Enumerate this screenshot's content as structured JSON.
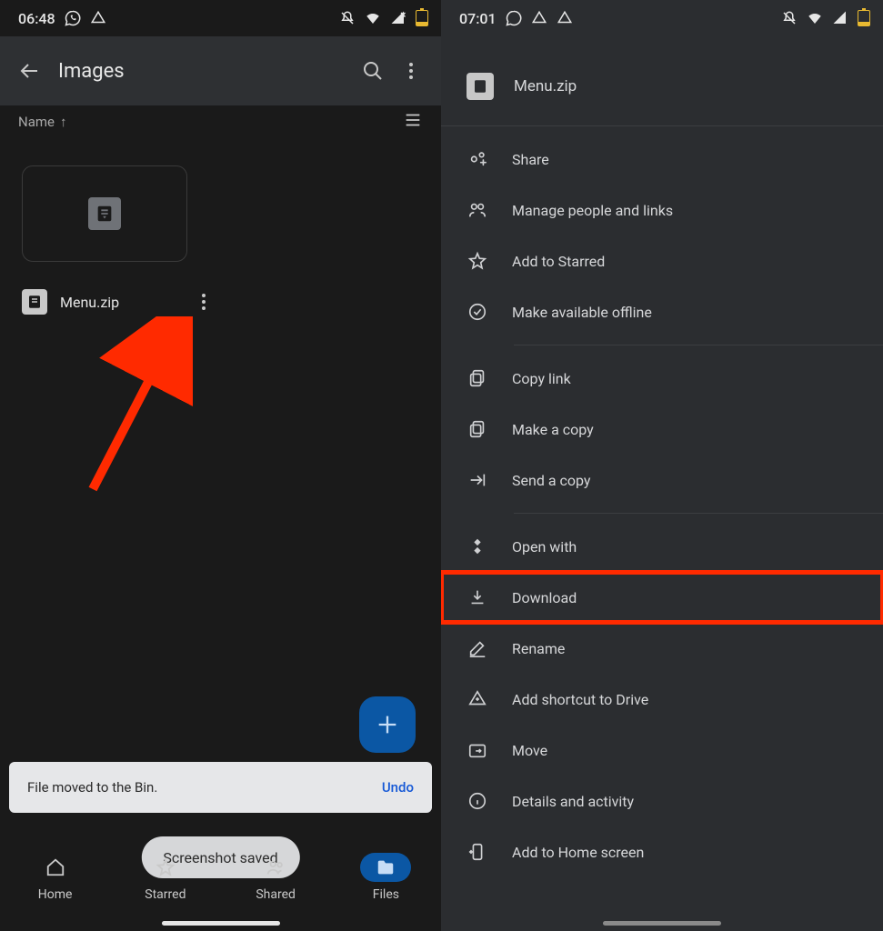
{
  "left": {
    "status": {
      "time": "06:48"
    },
    "header": {
      "title": "Images"
    },
    "sort": {
      "label": "Name"
    },
    "file": {
      "name": "Menu.zip"
    },
    "snackbar": {
      "text": "File moved to the Bin.",
      "action": "Undo"
    },
    "pill": {
      "text": "Screenshot saved"
    },
    "bottomnav": {
      "home": "Home",
      "starred": "Starred",
      "shared": "Shared",
      "files": "Files"
    }
  },
  "right": {
    "status": {
      "time": "07:01"
    },
    "file": "Menu.zip",
    "menu": {
      "share": "Share",
      "manage": "Manage people and links",
      "starred": "Add to Starred",
      "offline": "Make available offline",
      "copylink": "Copy link",
      "makecopy": "Make a copy",
      "sendcopy": "Send a copy",
      "openwith": "Open with",
      "download": "Download",
      "rename": "Rename",
      "shortcut": "Add shortcut to Drive",
      "move": "Move",
      "details": "Details and activity",
      "homescreen": "Add to Home screen"
    }
  }
}
